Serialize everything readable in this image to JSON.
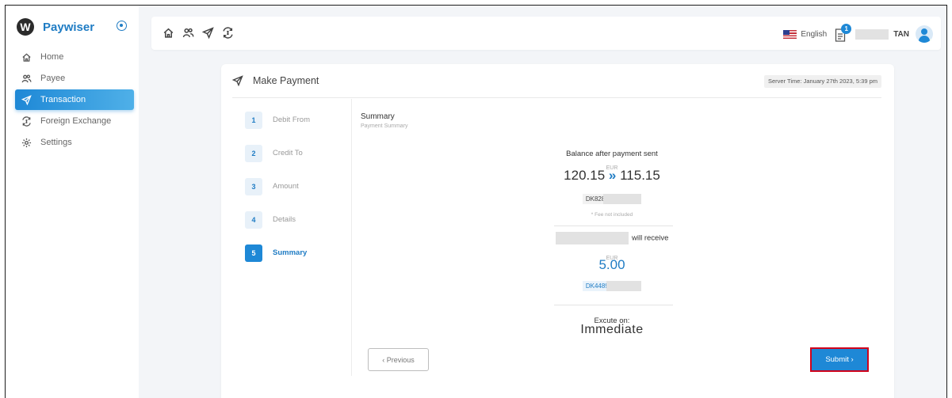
{
  "sidebar": {
    "brand": "Paywiser",
    "logo_letter": "W",
    "items": [
      {
        "label": "Home",
        "icon": "home-icon"
      },
      {
        "label": "Payee",
        "icon": "users-icon"
      },
      {
        "label": "Transaction",
        "icon": "send-icon",
        "active": true
      },
      {
        "label": "Foreign Exchange",
        "icon": "exchange-icon"
      },
      {
        "label": "Settings",
        "icon": "gear-icon"
      }
    ]
  },
  "topbar": {
    "language": "English",
    "notification_count": "1",
    "user_name_suffix": "TAN"
  },
  "payment": {
    "title": "Make Payment",
    "server_time": "Server Time: January 27th 2023, 5:39 pm",
    "steps": [
      {
        "num": "1",
        "label": "Debit From"
      },
      {
        "num": "2",
        "label": "Credit To"
      },
      {
        "num": "3",
        "label": "Amount"
      },
      {
        "num": "4",
        "label": "Details"
      },
      {
        "num": "5",
        "label": "Summary",
        "active": true
      }
    ],
    "summary_title": "Summary",
    "summary_subtitle": "Payment Summary",
    "balance_label": "Balance after payment sent",
    "balance_currency": "EUR",
    "balance_before": "120.15",
    "balance_arrow": "»",
    "balance_after": "115.15",
    "debit_account": "DK8289000",
    "fee_note": "* Fee not included",
    "receive_label": "will receive",
    "receive_currency": "EUR",
    "receive_amount": "5.00",
    "credit_account": "DK4489000",
    "execute_label": "Excute on:",
    "execute_value": "Immediate",
    "previous_label": "‹  Previous",
    "submit_label": "Submit  ›"
  },
  "colors": {
    "accent": "#1e88d6",
    "brand": "#1f7cc4",
    "highlight": "#d0021b"
  }
}
